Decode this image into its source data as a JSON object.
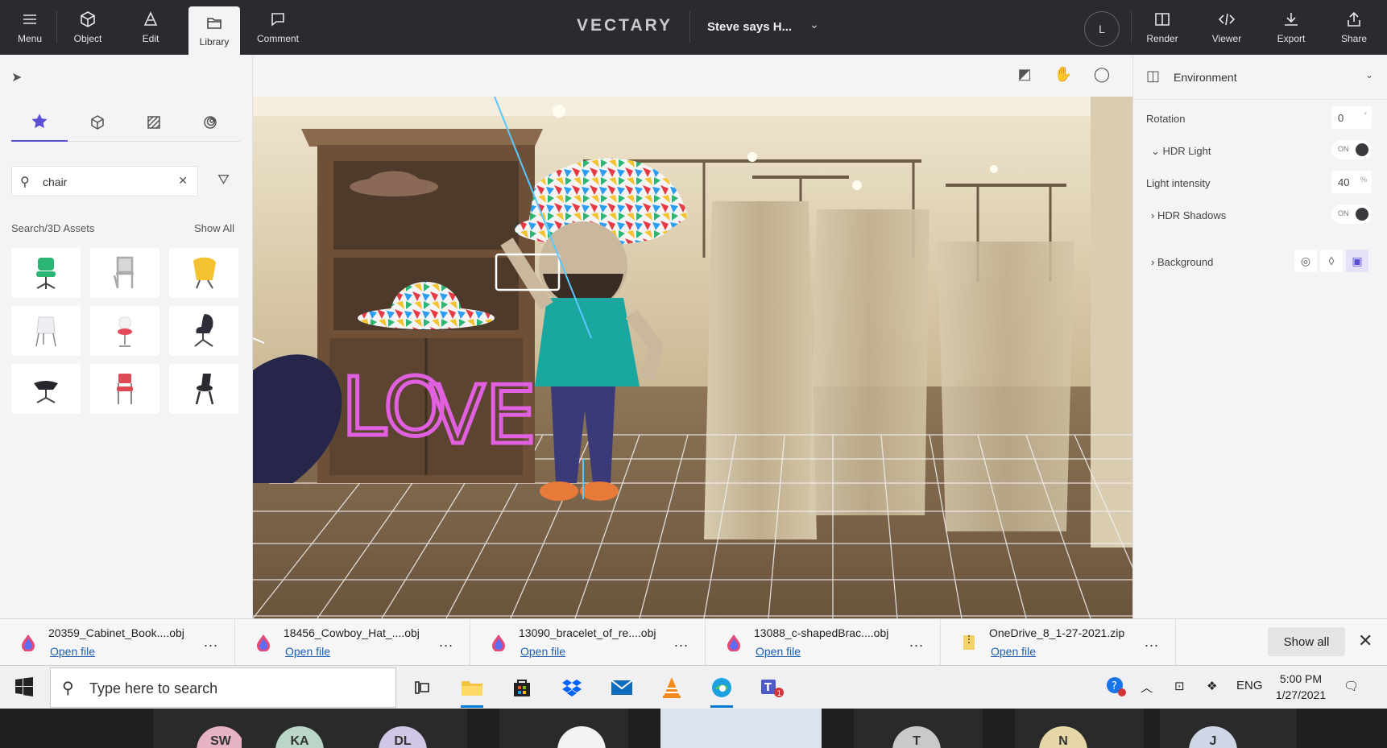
{
  "toolbar": {
    "items": [
      {
        "label": "Menu",
        "icon": "menu-icon"
      },
      {
        "label": "Object",
        "icon": "cube-icon"
      },
      {
        "label": "Edit",
        "icon": "edit-icon"
      },
      {
        "label": "Library",
        "icon": "library-icon"
      },
      {
        "label": "Comment",
        "icon": "comment-icon"
      }
    ],
    "brand": "VECTARY",
    "doc_title": "Steve says H...",
    "avatar_initial": "L",
    "right_items": [
      {
        "label": "Render",
        "icon": "render-icon"
      },
      {
        "label": "Viewer",
        "icon": "code-icon"
      },
      {
        "label": "Export",
        "icon": "download-icon"
      },
      {
        "label": "Share",
        "icon": "share-icon"
      }
    ]
  },
  "library": {
    "search_value": "chair",
    "section_label": "Search/3D Assets",
    "show_all": "Show All",
    "assets": [
      {
        "name": "green-office-chair",
        "color": "#2bb673"
      },
      {
        "name": "grey-frame-chair",
        "color": "#c4c4c4"
      },
      {
        "name": "yellow-lounge-chair",
        "color": "#f2c230"
      },
      {
        "name": "white-chair",
        "color": "#e8e8ee"
      },
      {
        "name": "red-stool-chair",
        "color": "#e64a5a"
      },
      {
        "name": "dark-lounge-chair",
        "color": "#2d2d38"
      },
      {
        "name": "black-swivel-chair",
        "color": "#26262c"
      },
      {
        "name": "red-dining-chair",
        "color": "#e04a55"
      },
      {
        "name": "black-bar-chair",
        "color": "#2a2a30"
      }
    ]
  },
  "scene": {
    "love_text_1": "LO",
    "love_text_2": "VE"
  },
  "environment": {
    "title": "Environment",
    "rotation_label": "Rotation",
    "rotation_value": "0",
    "rotation_unit": "°",
    "hdr_light_label": "HDR Light",
    "hdr_light_state": "ON",
    "light_intensity_label": "Light intensity",
    "light_intensity_value": "40",
    "light_intensity_unit": "%",
    "hdr_shadows_label": "HDR Shadows",
    "hdr_shadows_state": "ON",
    "background_label": "Background"
  },
  "downloads": {
    "items": [
      {
        "name": "20359_Cabinet_Book....obj",
        "action": "Open file",
        "type": "obj"
      },
      {
        "name": "18456_Cowboy_Hat_....obj",
        "action": "Open file",
        "type": "obj"
      },
      {
        "name": "13090_bracelet_of_re....obj",
        "action": "Open file",
        "type": "obj"
      },
      {
        "name": "13088_c-shapedBrac....obj",
        "action": "Open file",
        "type": "obj"
      },
      {
        "name": "OneDrive_8_1-27-2021.zip",
        "action": "Open file",
        "type": "zip"
      }
    ],
    "more": "...",
    "show_all": "Show all"
  },
  "taskbar": {
    "search_placeholder": "Type here to search",
    "language": "ENG",
    "time": "5:00 PM",
    "date": "1/27/2021"
  },
  "meeting": {
    "participants": [
      "SW",
      "KA",
      "DL",
      "",
      "",
      "T",
      "N",
      "J"
    ]
  }
}
